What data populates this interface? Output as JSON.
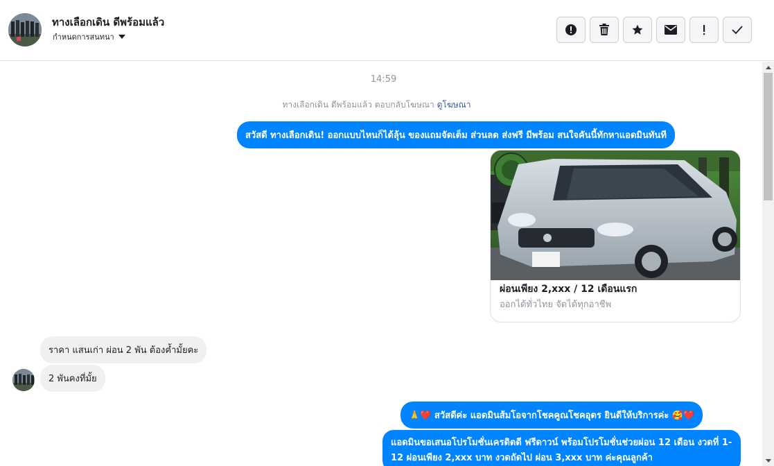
{
  "header": {
    "title": "ทางเลือกเดิน ดีพร้อมแล้ว",
    "subtitle": "กำหนดการสนทนา",
    "actions": [
      {
        "name": "report-icon",
        "label": "!"
      },
      {
        "name": "trash-icon",
        "label": ""
      },
      {
        "name": "star-icon",
        "label": ""
      },
      {
        "name": "envelope-icon",
        "label": ""
      },
      {
        "name": "spam-icon",
        "label": "!"
      },
      {
        "name": "check-icon",
        "label": ""
      }
    ]
  },
  "conversation": {
    "timestamp": "14:59",
    "ad_reply": {
      "text": "ทางเลือกเดิน ดีพร้อมแล้ว ตอบกลับโฆษณา",
      "link": "ดูโฆษณา"
    },
    "messages": [
      {
        "direction": "out",
        "text": "สวัสดี ทางเลือกเดิน! ออกแบบไหนก็ได้ลุ้น ของแถมจัดเต็ม ส่วนลด ส่งฟรี มีพร้อม สนใจคันนี้ทักหาแอดมินทันที"
      },
      {
        "direction": "in",
        "text": "ราคา  แสนเก่า ผ่อน 2 พัน ต้องค้ำมั้ยคะ"
      },
      {
        "direction": "in",
        "text": "2 พันคงที่มั้ย"
      },
      {
        "direction": "out",
        "text": "🙏❤️ สวัสดีค่ะ แอดมินส้มโอจากโชคคูณโชคอุดร ยินดีให้บริการค่ะ 🥰❤️"
      },
      {
        "direction": "out",
        "text": "แอดมินขอเสนอโปรโมชั่นเครดิตดี ฟรีดาวน์ พร้อมโปรโมชั่นช่วยผ่อน 12 เดือน งวดที่ 1-12 ผ่อนเพียง 2,xxx บาท งวดถัดไป ผ่อน 3,xxx บาท ค่ะคุณลูกค้า"
      }
    ],
    "ad_card": {
      "title": "ผ่อนเพียง 2,xxx / 12 เดือนแรก",
      "description": "ออกได้ทั่วไทย จัดได้ทุกอาชีพ"
    }
  },
  "colors": {
    "accent": "#0084ff",
    "incoming_bubble": "#f1f0f0",
    "link": "#385898",
    "muted_text": "#90949c"
  }
}
